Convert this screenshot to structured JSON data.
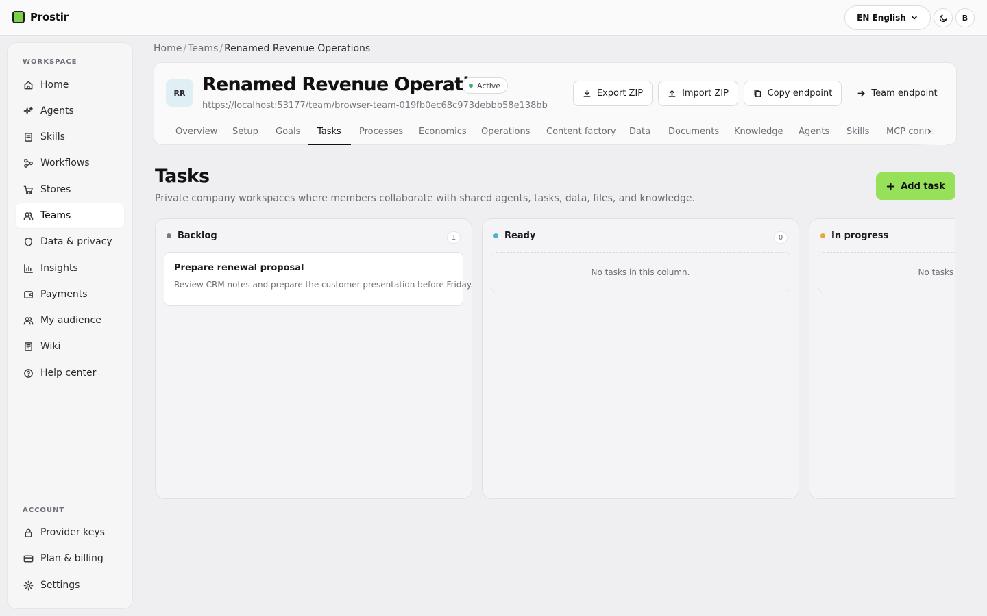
{
  "app": {
    "name": "Prostir"
  },
  "header": {
    "language_label": "EN English",
    "user_initial": "B"
  },
  "sidebar": {
    "workspace_heading": "WORKSPACE",
    "items": [
      {
        "label": "Home",
        "icon": "home-icon"
      },
      {
        "label": "Agents",
        "icon": "sparkles-icon"
      },
      {
        "label": "Skills",
        "icon": "book-icon"
      },
      {
        "label": "Workflows",
        "icon": "workflow-icon"
      },
      {
        "label": "Stores",
        "icon": "cart-icon"
      },
      {
        "label": "Teams",
        "icon": "users-icon",
        "active": true
      },
      {
        "label": "Data & privacy",
        "icon": "shield-icon"
      },
      {
        "label": "Insights",
        "icon": "bar-chart-icon"
      },
      {
        "label": "Payments",
        "icon": "wallet-icon"
      },
      {
        "label": "My audience",
        "icon": "audience-icon"
      },
      {
        "label": "Wiki",
        "icon": "wiki-icon"
      },
      {
        "label": "Help center",
        "icon": "help-icon"
      }
    ],
    "account_heading": "ACCOUNT",
    "account_items": [
      {
        "label": "Provider keys",
        "icon": "lock-icon"
      },
      {
        "label": "Plan & billing",
        "icon": "credit-card-icon"
      },
      {
        "label": "Settings",
        "icon": "gear-icon"
      }
    ]
  },
  "breadcrumb": {
    "items": [
      "Home",
      "Teams"
    ],
    "current": "Renamed Revenue Operations",
    "separator": "/"
  },
  "team": {
    "initials": "RR",
    "name": "Renamed Revenue Operations",
    "status": "Active",
    "url": "https://localhost:53177/team/browser-team-019fb0ec68c973debbb58e138bb",
    "actions": {
      "export": "Export ZIP",
      "import": "Import ZIP",
      "copy": "Copy endpoint",
      "endpoint": "Team endpoint"
    },
    "tabs": [
      "Overview",
      "Setup",
      "Goals",
      "Tasks",
      "Processes",
      "Economics",
      "Operations",
      "Content factory",
      "Data",
      "Documents",
      "Knowledge",
      "Agents",
      "Skills",
      "MCP connections"
    ],
    "active_tab": "Tasks"
  },
  "page": {
    "title": "Tasks",
    "description": "Private company workspaces where members collaborate with shared agents, tasks, data, files, and knowledge.",
    "add_button": "Add task"
  },
  "board": {
    "columns": [
      {
        "name": "Backlog",
        "count": "1",
        "color": "#7a7a80",
        "tasks": [
          {
            "title": "Prepare renewal proposal",
            "description": "Review CRM notes and prepare the customer presentation before Friday."
          }
        ]
      },
      {
        "name": "Ready",
        "count": "0",
        "color": "#4fb0d8",
        "empty_text": "No tasks in this column."
      },
      {
        "name": "In progress",
        "count": "",
        "color": "#e5a93a",
        "empty_text": "No tasks in this column."
      }
    ]
  },
  "colors": {
    "accent": "#96e05a",
    "brand": "#7ad14a",
    "active_status": "#38b26a"
  }
}
